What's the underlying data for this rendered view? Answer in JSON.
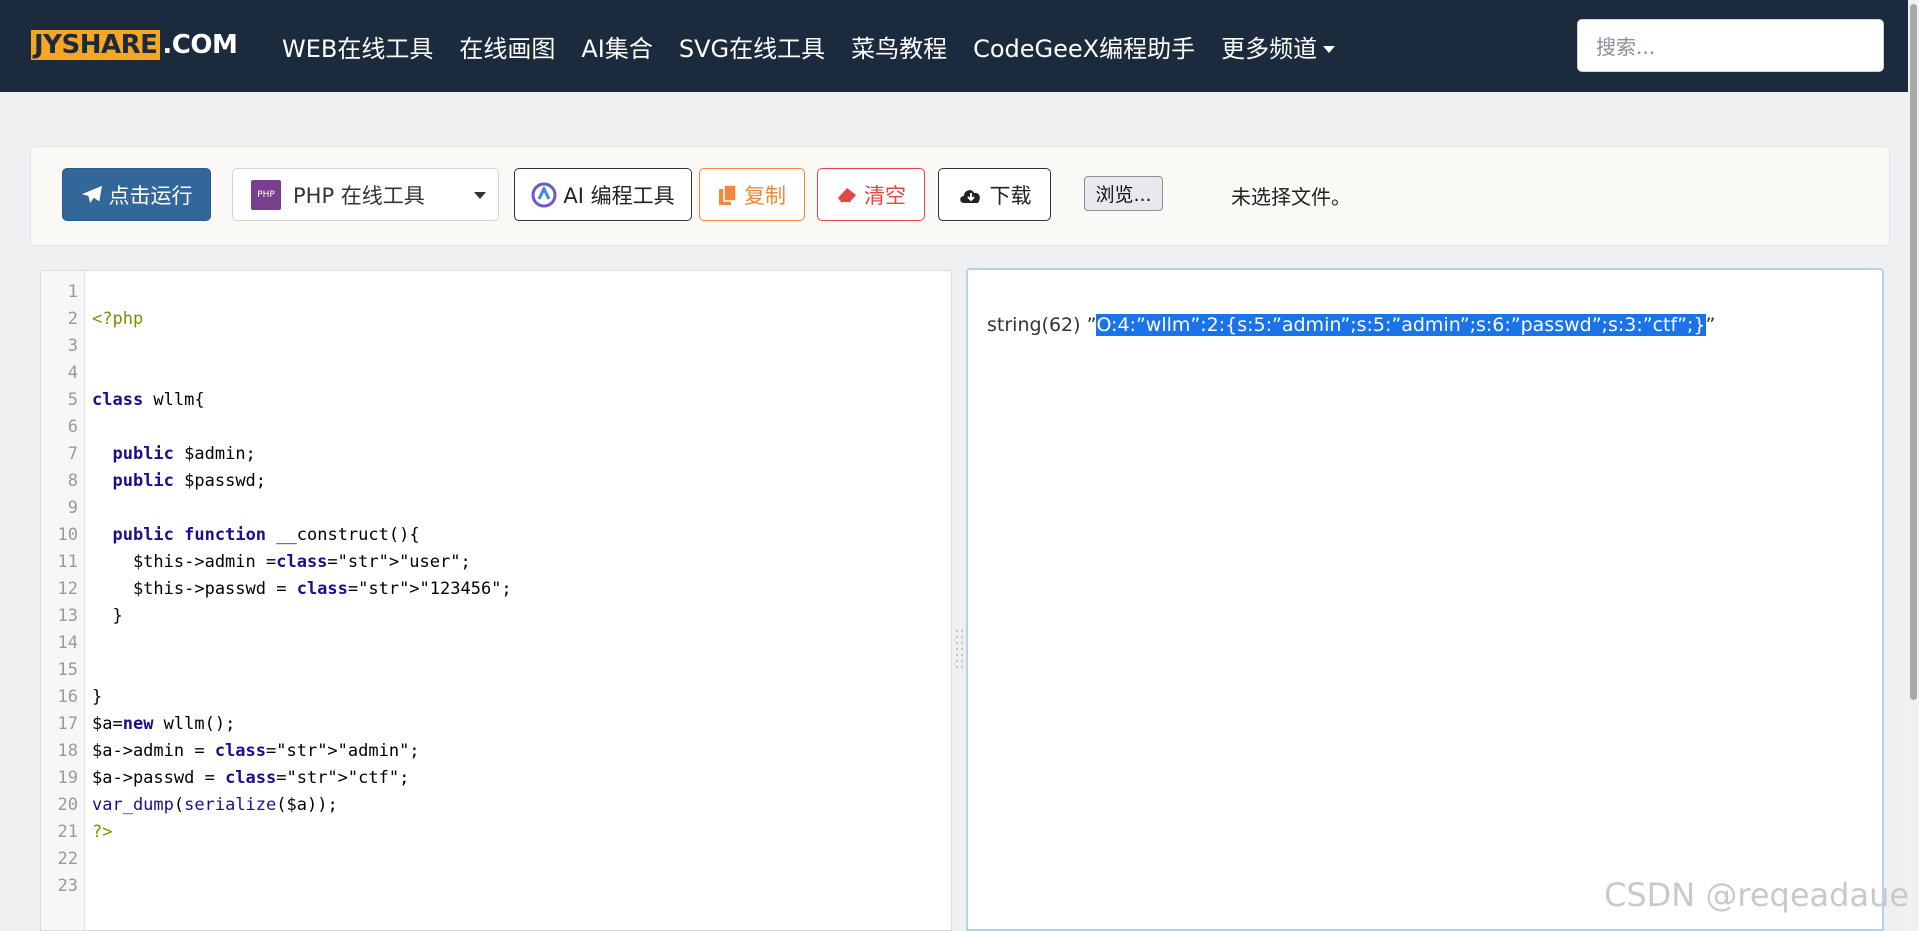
{
  "navbar": {
    "logo_main": "JYSHARE",
    "logo_suffix": ".COM",
    "links": [
      "WEB在线工具",
      "在线画图",
      "AI集合",
      "SVG在线工具",
      "菜鸟教程",
      "CodeGeeX编程助手",
      "更多频道"
    ],
    "search_placeholder": "搜索..."
  },
  "toolbar": {
    "run_label": "点击运行",
    "language_select": "PHP 在线工具",
    "php_badge": "PHP",
    "ai_label": "AI 编程工具",
    "copy_label": "复制",
    "clear_label": "清空",
    "download_label": "下载",
    "browse_label": "浏览...",
    "no_file_label": "未选择文件。"
  },
  "editor": {
    "line_numbers": [
      "1",
      "2",
      "3",
      "4",
      "5",
      "6",
      "7",
      "8",
      "9",
      "10",
      "11",
      "12",
      "13",
      "14",
      "15",
      "16",
      "17",
      "18",
      "19",
      "20",
      "21",
      "22",
      "23"
    ],
    "lines": [
      "",
      "<?php",
      "",
      "",
      "class wllm{",
      "",
      "  public $admin;",
      "  public $passwd;",
      "",
      "  public function __construct(){",
      "    $this->admin =\"user\";",
      "    $this->passwd = \"123456\";",
      "  }",
      "",
      "",
      "}",
      "$a=new wllm();",
      "$a->admin = \"admin\";",
      "$a->passwd = \"ctf\";",
      "var_dump(serialize($a));",
      "?>",
      "",
      ""
    ]
  },
  "output": {
    "prefix": "string(62) ”",
    "selected": "O:4:”wllm”:2:{s:5:”admin”;s:5:”admin”;s:6:”passwd”;s:3:”ctf”;}",
    "suffix": "”"
  },
  "watermark": "CSDN @reqeadaue",
  "colors": {
    "navbar": "#1c2a3d",
    "logo_accent": "#f5a623",
    "run_button": "#336699",
    "copy": "#f0883e",
    "clear": "#e04848",
    "selection": "#1a73e8"
  }
}
